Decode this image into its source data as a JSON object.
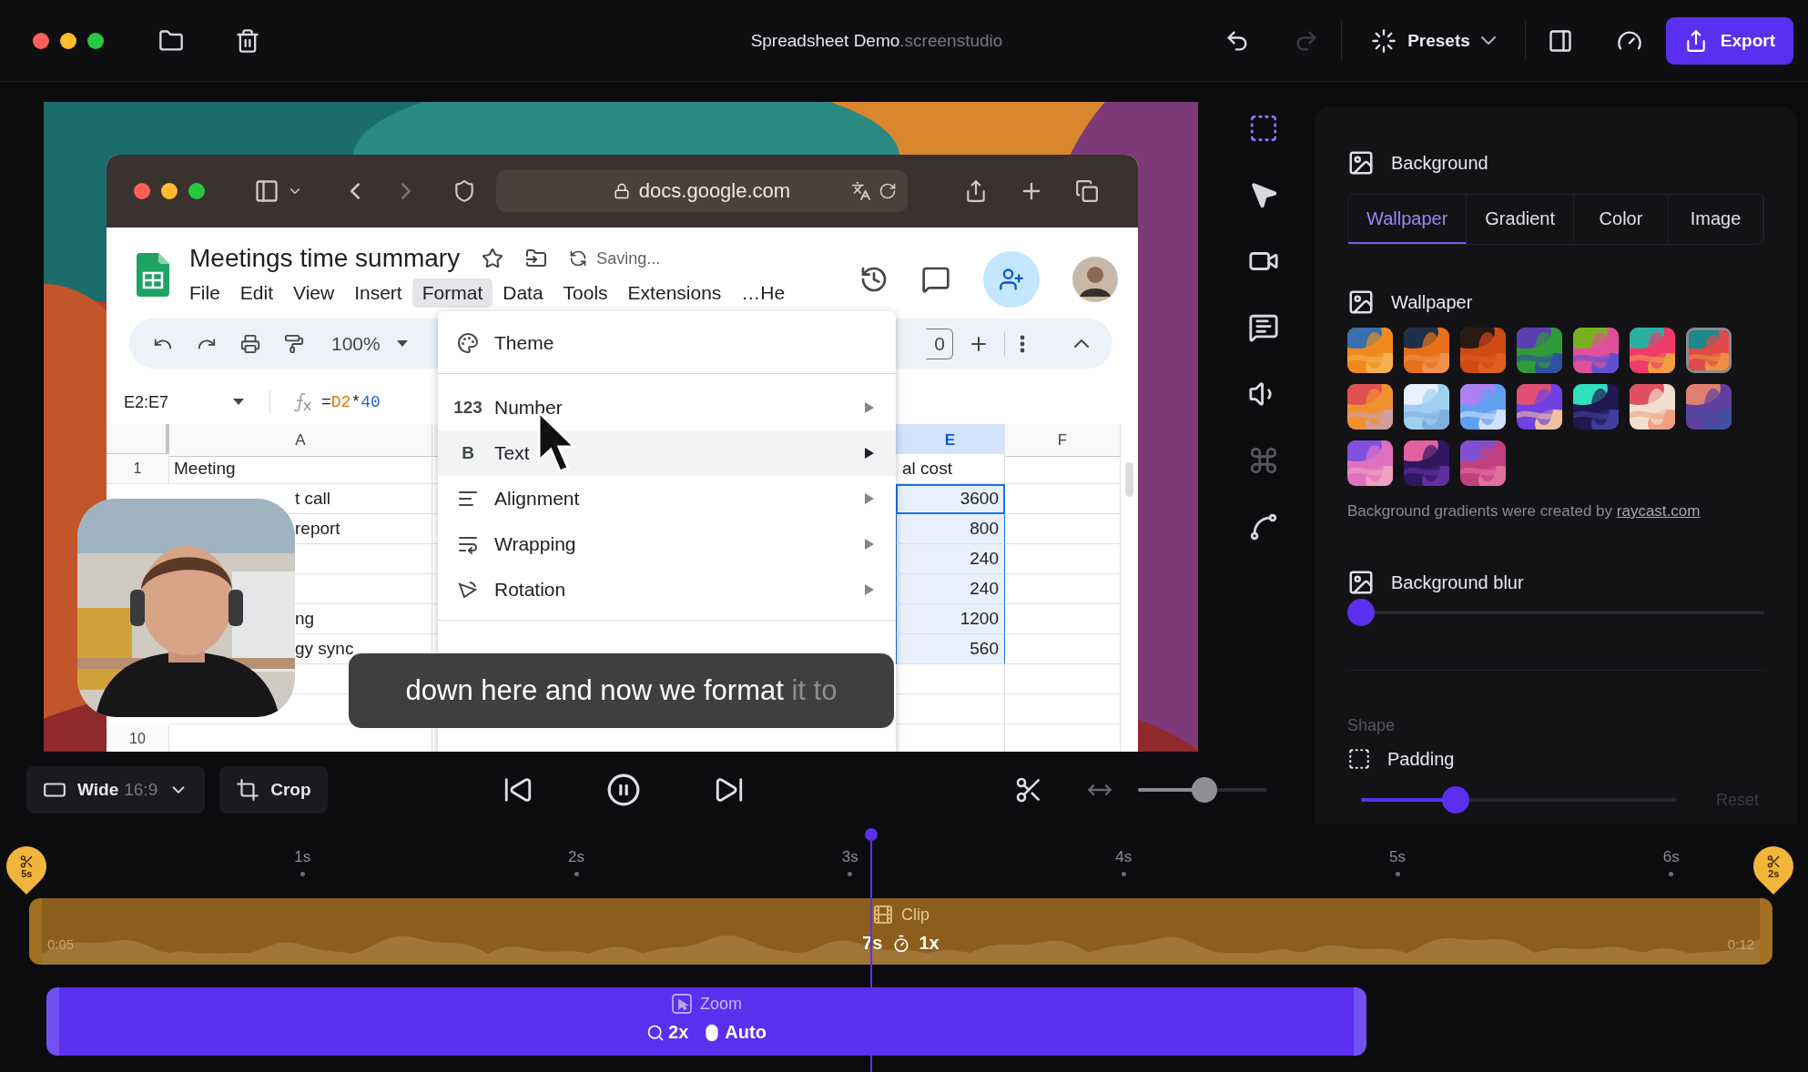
{
  "window": {
    "title": "Spreadsheet Demo",
    "title_suffix": ".screenstudio"
  },
  "history": [
    {
      "kind": "undo",
      "disabled": false
    },
    {
      "kind": "redo",
      "disabled": true
    }
  ],
  "presets": "Presets",
  "export": "Export",
  "recording": {
    "browser": {
      "url": "docs.google.com"
    },
    "sheet": {
      "title": "Meetings time summary",
      "status": "Saving...",
      "menu": [
        {
          "label": "File",
          "selected": false
        },
        {
          "label": "Edit",
          "selected": false
        },
        {
          "label": "View",
          "selected": false
        },
        {
          "label": "Insert",
          "selected": false
        },
        {
          "label": "Format",
          "selected": true
        },
        {
          "label": "Data",
          "selected": false
        },
        {
          "label": "Tools",
          "selected": false
        },
        {
          "label": "Extensions",
          "selected": false
        },
        {
          "label": "…He",
          "selected": false
        }
      ],
      "zoom": "100%",
      "size_fragment": "0",
      "name_box": "E2:E7",
      "formula": [
        {
          "text": "=",
          "kind": "plain"
        },
        {
          "text": "D2",
          "kind": "ref"
        },
        {
          "text": "*",
          "kind": "plain"
        },
        {
          "text": "40",
          "kind": "number"
        }
      ],
      "columns": [
        {
          "label": "A",
          "selected": false
        },
        {
          "label": "E",
          "selected": true
        },
        {
          "label": "F",
          "selected": false
        }
      ],
      "rows": [
        {
          "number": "1",
          "a": {
            "text": "Meeting",
            "kind": "full"
          },
          "e": {
            "text": "al cost",
            "kind": "text",
            "selected": false,
            "active": false
          }
        },
        {
          "a": {
            "text": "t call",
            "kind": "partial"
          },
          "e": {
            "text": "3600",
            "kind": "number",
            "selected": true,
            "active": true
          }
        },
        {
          "a": {
            "text": "report",
            "kind": "partial"
          },
          "e": {
            "text": "800",
            "kind": "number",
            "selected": true,
            "active": false
          }
        },
        {
          "e": {
            "text": "240",
            "kind": "number",
            "selected": true,
            "active": false
          }
        },
        {
          "e": {
            "text": "240",
            "kind": "number",
            "selected": true,
            "active": false
          }
        },
        {
          "a": {
            "text": "ng",
            "kind": "partial"
          },
          "e": {
            "text": "1200",
            "kind": "number",
            "selected": true,
            "active": false
          }
        },
        {
          "a": {
            "text": "gy sync",
            "kind": "partial"
          },
          "e": {
            "text": "560",
            "kind": "number",
            "selected": true,
            "active": false
          }
        },
        {},
        {},
        {
          "number": "10"
        }
      ]
    },
    "format_menu": [
      {
        "items": [
          {
            "label": "Theme",
            "selected": false,
            "submenu": false
          }
        ]
      },
      {
        "items": [
          {
            "label": "Number",
            "glyph": "123",
            "selected": false,
            "submenu": true
          },
          {
            "label": "Text",
            "glyph": "B",
            "selected": true,
            "submenu": true
          },
          {
            "label": "Alignment",
            "selected": false,
            "submenu": true
          },
          {
            "label": "Wrapping",
            "selected": false,
            "submenu": true
          },
          {
            "label": "Rotation",
            "selected": false,
            "submenu": true
          }
        ]
      }
    ],
    "caption": {
      "spoken": "down here and now we format",
      "upcoming": "it to"
    }
  },
  "rail": [
    {
      "kind": "frame",
      "selected": true,
      "disabled": false
    },
    {
      "kind": "cursor",
      "selected": false,
      "disabled": false
    },
    {
      "kind": "camera",
      "selected": false,
      "disabled": false
    },
    {
      "kind": "captions",
      "selected": false,
      "disabled": false
    },
    {
      "kind": "audio",
      "selected": false,
      "disabled": false
    },
    {
      "kind": "shortcuts",
      "selected": false,
      "disabled": true
    },
    {
      "kind": "path",
      "selected": false,
      "disabled": false
    }
  ],
  "panel": {
    "background": {
      "title": "Background",
      "tabs": [
        {
          "label": "Wallpaper",
          "selected": true
        },
        {
          "label": "Gradient",
          "selected": false
        },
        {
          "label": "Color",
          "selected": false
        },
        {
          "label": "Image",
          "selected": false
        }
      ]
    },
    "wallpaper": {
      "title": "Wallpaper",
      "swatches": [
        {
          "selected": false
        },
        {
          "selected": false
        },
        {
          "selected": false
        },
        {
          "selected": false
        },
        {
          "selected": false
        },
        {
          "selected": false
        },
        {
          "selected": true
        },
        {
          "selected": false
        },
        {
          "selected": false
        },
        {
          "selected": false
        },
        {
          "selected": false
        },
        {
          "selected": false
        },
        {
          "selected": false
        },
        {
          "selected": false
        },
        {
          "selected": false
        },
        {
          "selected": false
        },
        {
          "selected": false
        }
      ],
      "credit": "Background gradients were created by",
      "credit_link": "raycast.com"
    },
    "blur": {
      "title": "Background blur",
      "level": 0
    },
    "shape": {
      "title": "Shape",
      "padding": {
        "title": "Padding",
        "level": 0.3
      },
      "reset": {
        "label": "Reset",
        "disabled": true
      }
    }
  },
  "controls": {
    "aspect": "Wide",
    "ratio": "16:9",
    "crop": "Crop",
    "zoom": {
      "level": 0.52
    }
  },
  "timeline": {
    "ticks": [
      "1s",
      "2s",
      "3s",
      "4s",
      "5s",
      "6s"
    ],
    "start_trim": "5s",
    "end_trim": "2s",
    "clip": {
      "label": "Clip",
      "start": "0:05",
      "end": "0:12",
      "duration": "7s",
      "speed": "1x"
    },
    "zoom": {
      "label": "Zoom",
      "scale": "2x",
      "mode": "Auto"
    }
  }
}
